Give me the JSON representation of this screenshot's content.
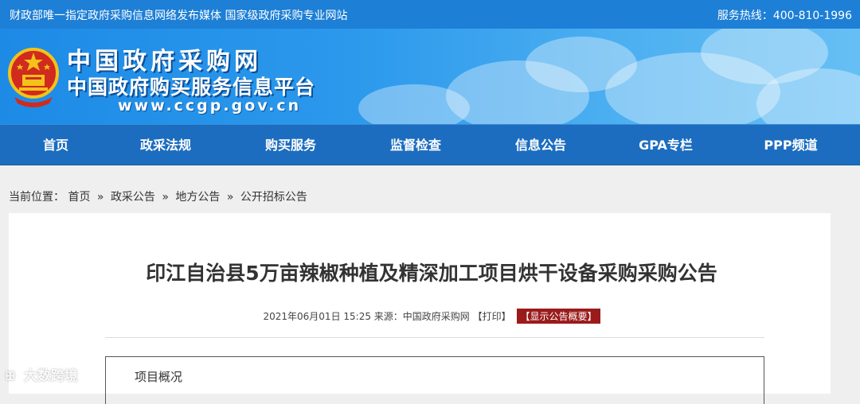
{
  "topbar": {
    "tagline": "财政部唯一指定政府采购信息网络发布媒体 国家级政府采购专业网站",
    "hotline": "服务热线：400-810-1996"
  },
  "banner": {
    "title_cn": "中国政府采购网",
    "subtitle_cn": "中国政府购买服务信息平台",
    "url": "www.ccgp.gov.cn"
  },
  "nav": {
    "items": [
      {
        "label": "首页"
      },
      {
        "label": "政采法规"
      },
      {
        "label": "购买服务"
      },
      {
        "label": "监督检查"
      },
      {
        "label": "信息公告"
      },
      {
        "label": "GPA专栏"
      },
      {
        "label": "PPP频道"
      }
    ]
  },
  "breadcrumb": {
    "prefix": "当前位置：",
    "items": [
      "首页",
      "政采公告",
      "地方公告",
      "公开招标公告"
    ],
    "separator": "»"
  },
  "article": {
    "title": "印江自治县5万亩辣椒种植及精深加工项目烘干设备采购采购公告",
    "date": "2021年06月01日 15:25",
    "source": "来源：中国政府采购网",
    "print_label": "【打印】",
    "summary_label": "【显示公告概要】",
    "section_title": "项目概况"
  },
  "watermark": {
    "text": "大数跨境"
  },
  "colors": {
    "topbar": "#1d7fd6",
    "nav": "#1c6dbf",
    "summary_button": "#9b1b1b",
    "page_bg": "#efefef"
  }
}
